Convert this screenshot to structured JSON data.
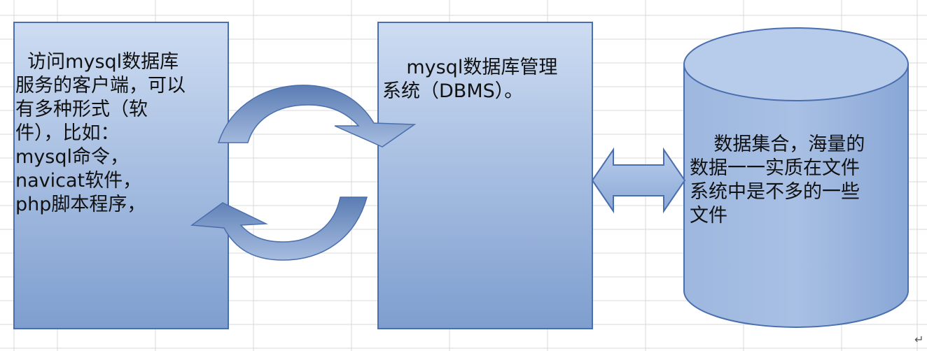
{
  "client_box": {
    "lines": [
      "  访问mysql数据库",
      "服务的客户端，可以",
      "有多种形式（软",
      "件），比如：",
      "mysql命令，",
      "navicat软件，",
      "php脚本程序，"
    ]
  },
  "dbms_box": {
    "lines": [
      "    mysql数据库管理",
      "系统（DBMS）。"
    ]
  },
  "data_cylinder": {
    "lines": [
      "    数据集合，海量的",
      "数据一一实质在文件",
      "系统中是不多的一些",
      "文件"
    ]
  },
  "colors": {
    "box_fill_top": "#c9d9f0",
    "box_fill_bottom": "#7f9fd0",
    "box_border": "#4a6fae",
    "arrow_fill": "#6f8fbf",
    "grid": "#d8d8d8"
  },
  "icons": {
    "paragraph_mark": "return-arrow-icon",
    "paragraph_mark_glyph": "↵"
  }
}
